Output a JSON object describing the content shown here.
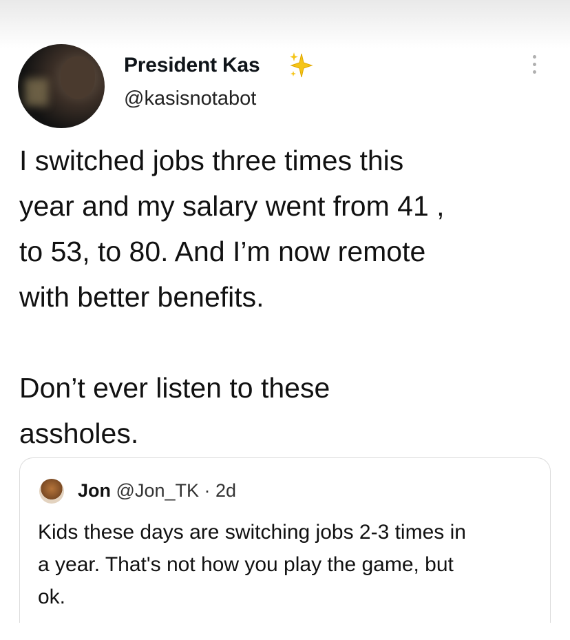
{
  "tweet": {
    "display_name": "President Kas",
    "handle": "@kasisnotabot",
    "text": "I switched jobs three times this\nyear and my salary went from 41 ,\nto 53, to 80. And I’m now remote\nwith better benefits.\n\nDon’t ever listen to these\nassholes."
  },
  "quoted_tweet": {
    "display_name": "Jon",
    "handle": "@Jon_TK",
    "separator": "·",
    "time": "2d",
    "text": "Kids these days are switching jobs 2-3 times in\na year. That's not how you play the game, but\nok."
  },
  "icons": {
    "name_badge": "sparkle-icon",
    "menu": "more-vertical-icon"
  },
  "colors": {
    "sparkle_fill": "#f5c518",
    "text": "#0f1419"
  }
}
